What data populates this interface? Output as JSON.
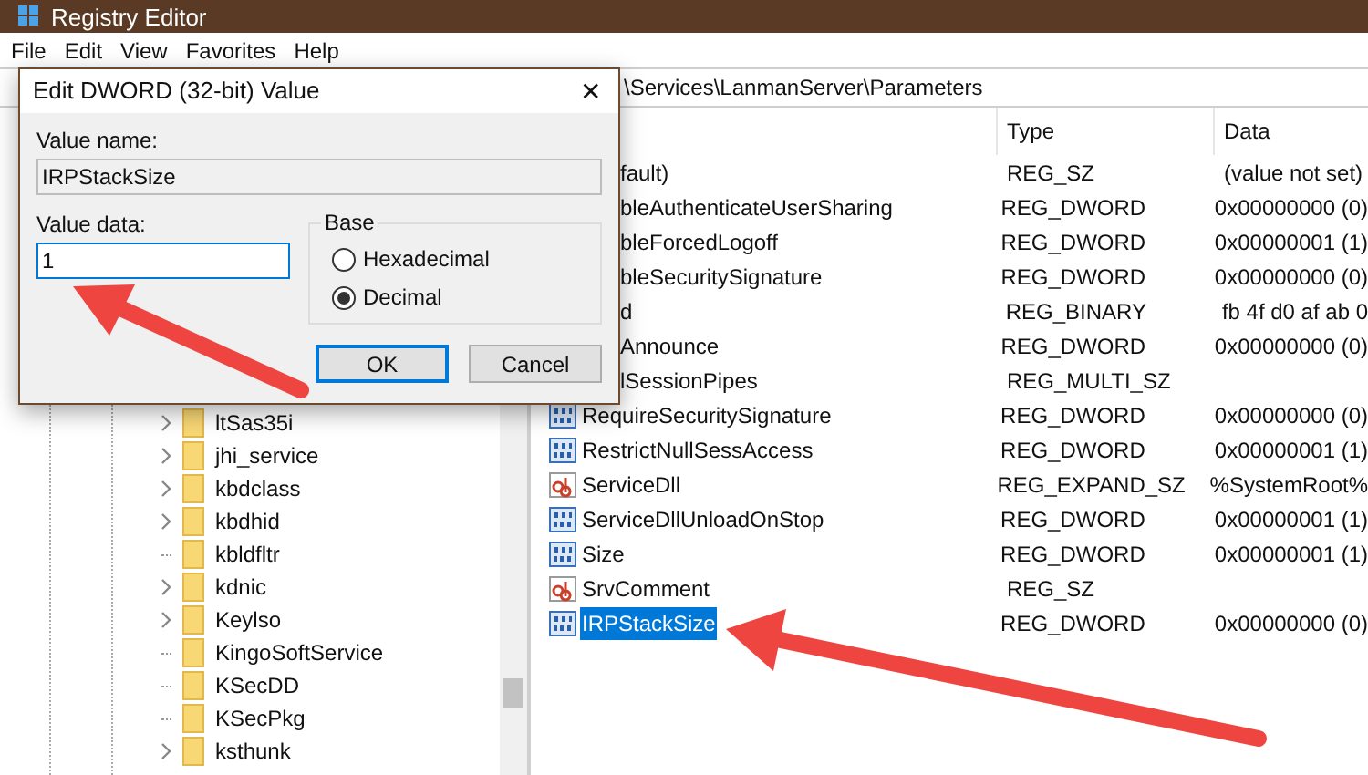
{
  "window": {
    "title": "Registry Editor"
  },
  "menu": [
    "File",
    "Edit",
    "View",
    "Favorites",
    "Help"
  ],
  "address": "\\Services\\LanmanServer\\Parameters",
  "tree": [
    {
      "name": "ltSas35i",
      "expandable": true
    },
    {
      "name": "jhi_service",
      "expandable": true
    },
    {
      "name": "kbdclass",
      "expandable": true
    },
    {
      "name": "kbdhid",
      "expandable": true
    },
    {
      "name": "kbldfltr",
      "expandable": false
    },
    {
      "name": "kdnic",
      "expandable": true
    },
    {
      "name": "Keylso",
      "expandable": true
    },
    {
      "name": "KingoSoftService",
      "expandable": false
    },
    {
      "name": "KSecDD",
      "expandable": false
    },
    {
      "name": "KSecPkg",
      "expandable": false
    },
    {
      "name": "ksthunk",
      "expandable": true
    }
  ],
  "list": {
    "columns": [
      "Type",
      "Data"
    ],
    "rows": [
      {
        "name": "fault)",
        "type": "REG_SZ",
        "data": "(value not set)",
        "selected": false
      },
      {
        "name": "bleAuthenticateUserSharing",
        "type": "REG_DWORD",
        "data": "0x00000000 (0)",
        "selected": false
      },
      {
        "name": "bleForcedLogoff",
        "type": "REG_DWORD",
        "data": "0x00000001 (1)",
        "selected": false
      },
      {
        "name": "bleSecuritySignature",
        "type": "REG_DWORD",
        "data": "0x00000000 (0)",
        "selected": false
      },
      {
        "name": "d",
        "type": "REG_BINARY",
        "data": "fb 4f d0 af ab 0",
        "selected": false
      },
      {
        "name": "Announce",
        "type": "REG_DWORD",
        "data": "0x00000000 (0)",
        "selected": false
      },
      {
        "name": "lSessionPipes",
        "type": "REG_MULTI_SZ",
        "selected": false
      },
      {
        "kind": "dword",
        "name": "RequireSecuritySignature",
        "type": "REG_DWORD",
        "data": "0x00000000 (0)",
        "selected": false
      },
      {
        "kind": "dword",
        "name": "RestrictNullSessAccess",
        "type": "REG_DWORD",
        "data": "0x00000001 (1)",
        "selected": false
      },
      {
        "kind": "string",
        "name": "ServiceDll",
        "type": "REG_EXPAND_SZ",
        "data": "%SystemRoot%",
        "selected": false
      },
      {
        "kind": "dword",
        "name": "ServiceDllUnloadOnStop",
        "type": "REG_DWORD",
        "data": "0x00000001 (1)",
        "selected": false
      },
      {
        "kind": "dword",
        "name": "Size",
        "type": "REG_DWORD",
        "data": "0x00000001 (1)",
        "selected": false
      },
      {
        "kind": "string",
        "name": "SrvComment",
        "type": "REG_SZ",
        "selected": false
      },
      {
        "kind": "dword",
        "name": "IRPStackSize",
        "type": "REG_DWORD",
        "data": "0x00000000 (0)",
        "selected": true
      }
    ]
  },
  "dialog": {
    "title": "Edit DWORD (32-bit) Value",
    "close": "✕",
    "value_name_label": "Value name:",
    "value_name": "IRPStackSize",
    "value_data_label": "Value data:",
    "value_data": "1",
    "base_label": "Base",
    "base_options": [
      {
        "label": "Hexadecimal",
        "selected": false
      },
      {
        "label": "Decimal",
        "selected": true
      }
    ],
    "buttons": [
      {
        "label": "OK",
        "default": true
      },
      {
        "label": "Cancel",
        "default": false
      }
    ]
  }
}
